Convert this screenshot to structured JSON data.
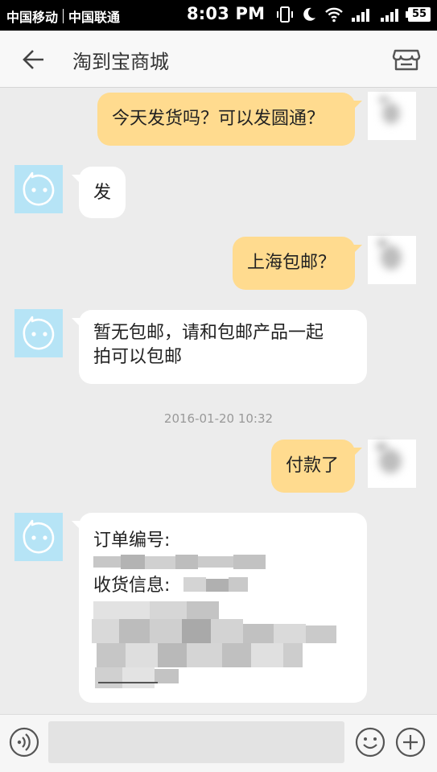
{
  "status_bar": {
    "carrier1": "中国移动",
    "carrier2": "中国联通",
    "time": "8:03 PM",
    "battery": "55",
    "icons": [
      "vibrate-icon",
      "moon-icon",
      "wifi-icon",
      "signal-icon",
      "signal-icon",
      "battery-icon"
    ]
  },
  "header": {
    "title": "淘到宝商城",
    "back_icon": "back-arrow-icon",
    "shop_icon": "shop-icon"
  },
  "messages": [
    {
      "side": "me",
      "text": "今天发货吗？可以发圆通？"
    },
    {
      "side": "shop",
      "text": "发"
    },
    {
      "side": "me",
      "text": "上海包邮？"
    },
    {
      "side": "shop",
      "lines": [
        "暂无包邮，请和包邮产品一起",
        "拍可以包邮"
      ]
    },
    {
      "side": "me",
      "text": "付款了"
    },
    {
      "side": "shop",
      "order_lines": [
        "订单编号:",
        "收货信息:"
      ]
    }
  ],
  "timestamp": "2016-01-20 10:32",
  "input_bar": {
    "voice_icon": "voice-icon",
    "input_placeholder": "",
    "emoji_icon": "emoji-icon",
    "plus_icon": "plus-icon"
  },
  "colors": {
    "my_bubble": "#ffdb8f",
    "shop_bubble": "#ffffff",
    "shop_avatar": "#b6e4f6",
    "background": "#ececec"
  }
}
